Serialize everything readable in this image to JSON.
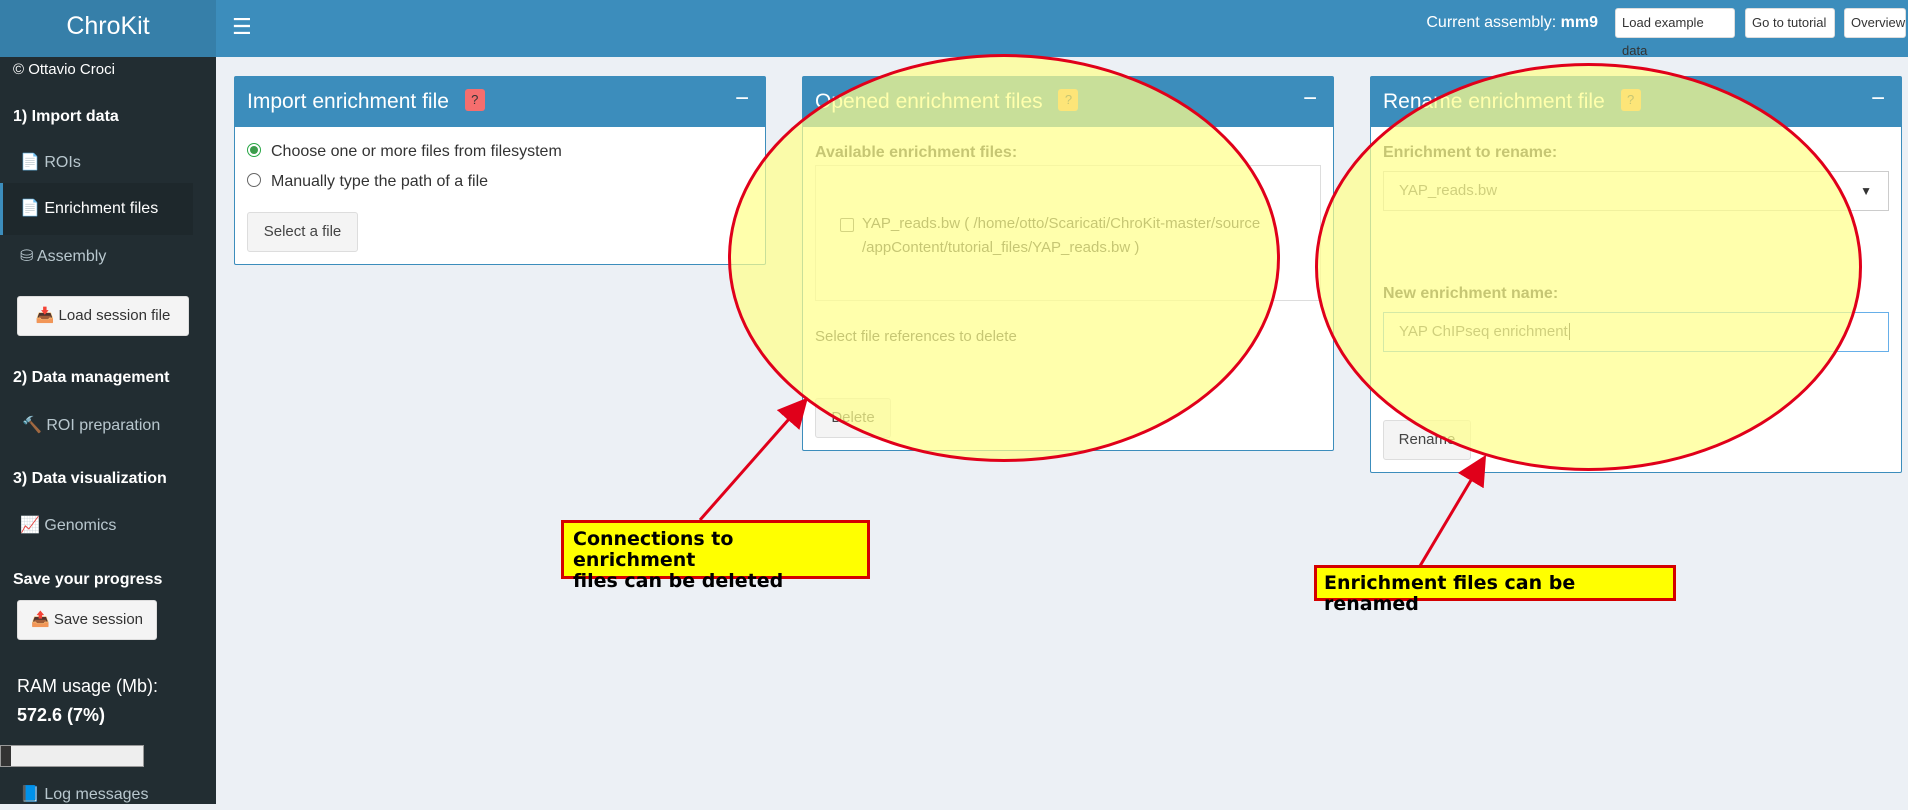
{
  "app": {
    "title": "ChroKit"
  },
  "topbar": {
    "assembly_label": "Current assembly:",
    "assembly_value": "mm9",
    "buttons": [
      "Load example data",
      "Go to tutorial",
      "Overview"
    ]
  },
  "sidebar": {
    "copyright": "© Ottavio Croci",
    "section1": "1) Import data",
    "item_rois": "ROIs",
    "item_enrichment": "Enrichment files",
    "item_assembly": "Assembly",
    "load_session": "Load session file",
    "section2": "2) Data management",
    "item_roi_prep": "ROI preparation",
    "section3": "3) Data visualization",
    "item_genomics": "Genomics",
    "save_progress": "Save your progress",
    "save_session": "Save session",
    "ram_label": "RAM usage (Mb):",
    "ram_value": "572.6 (7%)",
    "ram_fraction": 0.07,
    "log_messages": "Log messages"
  },
  "import_box": {
    "title": "Import enrichment file",
    "help": "?",
    "radio_options": [
      "Choose one or more files from filesystem",
      "Manually type the path of a file"
    ],
    "selected_option": 0,
    "select_button": "Select a file"
  },
  "opened_box": {
    "title": "Opened enrichment files",
    "help": "?",
    "available_label": "Available enrichment files:",
    "file_line1": "YAP_reads.bw ( /home/otto/Scaricati/ChroKit-master/source",
    "file_line2": "/appContent/tutorial_files/YAP_reads.bw )",
    "hint": "Select file references to delete",
    "delete_button": "Delete"
  },
  "rename_box": {
    "title": "Rename enrichment file",
    "help": "?",
    "to_rename_label": "Enrichment to rename:",
    "selected_value": "YAP_reads.bw",
    "new_name_label": "New enrichment name:",
    "new_name_value": "YAP ChIPseq enrichment",
    "rename_button": "Rename"
  },
  "annotations": {
    "delete_note_line1": "Connections to enrichment",
    "delete_note_line2": "files can be deleted",
    "rename_note": "Enrichment files can be renamed"
  },
  "colors": {
    "header": "#3c8dbc",
    "sidebar": "#222d32",
    "highlight": "#ffff00",
    "annotation_red": "#e0001a"
  }
}
